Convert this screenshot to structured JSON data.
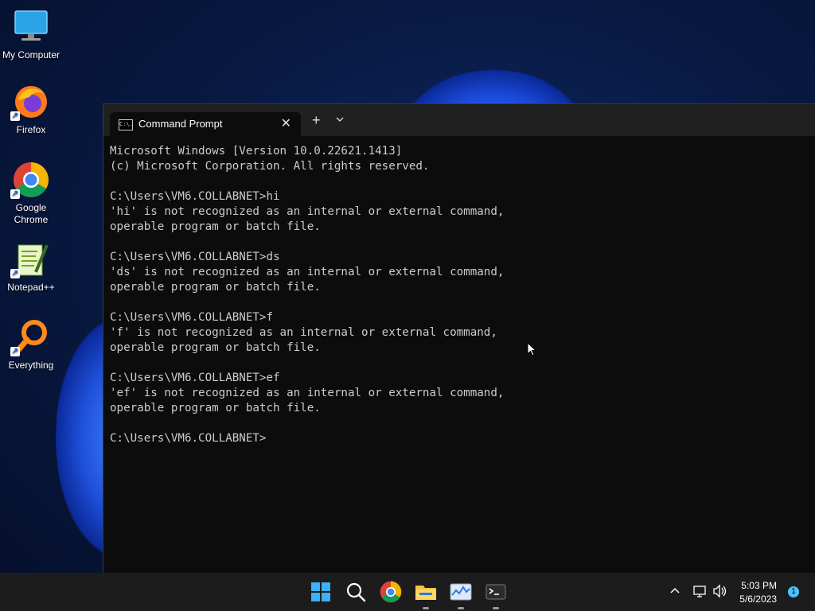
{
  "desktop": {
    "icons": [
      {
        "label": "My Computer",
        "icon": "monitor-icon"
      },
      {
        "label": "Firefox",
        "icon": "firefox-icon"
      },
      {
        "label": "Google Chrome",
        "icon": "chrome-icon"
      },
      {
        "label": "Notepad++",
        "icon": "notepadpp-icon"
      },
      {
        "label": "Everything",
        "icon": "everything-search-icon"
      }
    ]
  },
  "terminal": {
    "tab_title": "Command Prompt",
    "tab_icon_text": "C:\\.",
    "new_tab_label": "+",
    "close_label": "✕",
    "menu_label": "⌄",
    "lines": [
      "Microsoft Windows [Version 10.0.22621.1413]",
      "(c) Microsoft Corporation. All rights reserved.",
      "",
      "C:\\Users\\VM6.COLLABNET>hi",
      "'hi' is not recognized as an internal or external command,",
      "operable program or batch file.",
      "",
      "C:\\Users\\VM6.COLLABNET>ds",
      "'ds' is not recognized as an internal or external command,",
      "operable program or batch file.",
      "",
      "C:\\Users\\VM6.COLLABNET>f",
      "'f' is not recognized as an internal or external command,",
      "operable program or batch file.",
      "",
      "C:\\Users\\VM6.COLLABNET>ef",
      "'ef' is not recognized as an internal or external command,",
      "operable program or batch file.",
      "",
      "C:\\Users\\VM6.COLLABNET>"
    ]
  },
  "taskbar": {
    "apps": [
      "start-icon",
      "search-icon",
      "chrome-icon",
      "file-explorer-icon",
      "task-manager-icon",
      "terminal-icon"
    ],
    "clock_time": "5:03 PM",
    "clock_date": "5/6/2023",
    "notification_count": "1"
  },
  "colors": {
    "console_bg": "#0c0c0c",
    "console_text": "#cccccc",
    "taskbar_bg": "#1c1c1c",
    "titlebar_bg": "#202020"
  }
}
